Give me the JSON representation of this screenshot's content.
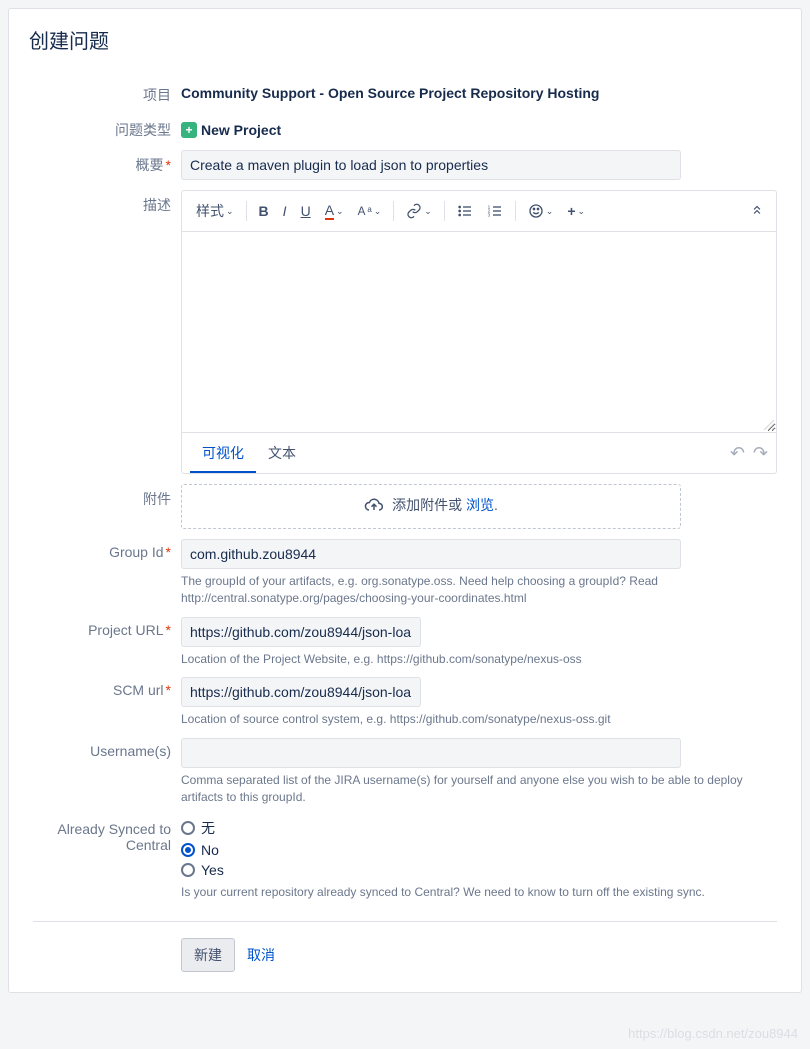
{
  "header": {
    "title": "创建问题"
  },
  "fields": {
    "project": {
      "label": "项目",
      "value": "Community Support - Open Source Project Repository Hosting"
    },
    "issueType": {
      "label": "问题类型",
      "value": "New Project"
    },
    "summary": {
      "label": "概要",
      "value": "Create a maven plugin to load json to properties"
    },
    "description": {
      "label": "描述"
    },
    "attachment": {
      "label": "附件",
      "text": "添加附件或 ",
      "browse": "浏览"
    },
    "groupId": {
      "label": "Group Id",
      "value": "com.github.zou8944",
      "help": "The groupId of your artifacts, e.g. org.sonatype.oss. Need help choosing a groupId? Read http://central.sonatype.org/pages/choosing-your-coordinates.html"
    },
    "projectUrl": {
      "label": "Project URL",
      "value": "https://github.com/zou8944/json-loa",
      "help": "Location of the Project Website, e.g. https://github.com/sonatype/nexus-oss"
    },
    "scmUrl": {
      "label": "SCM url",
      "value": "https://github.com/zou8944/json-loa",
      "help": "Location of source control system, e.g. https://github.com/sonatype/nexus-oss.git"
    },
    "usernames": {
      "label": "Username(s)",
      "value": "",
      "help": "Comma separated list of the JIRA username(s) for yourself and anyone else you wish to be able to deploy artifacts to this groupId."
    },
    "synced": {
      "label": "Already Synced to Central",
      "options": {
        "none": "无",
        "no": "No",
        "yes": "Yes"
      },
      "help": "Is your current repository already synced to Central? We need to know to turn off the existing sync."
    }
  },
  "editor": {
    "styleBtn": "样式",
    "tabs": {
      "visual": "可视化",
      "text": "文本"
    }
  },
  "footer": {
    "submit": "新建",
    "cancel": "取消"
  },
  "watermark": "https://blog.csdn.net/zou8944"
}
